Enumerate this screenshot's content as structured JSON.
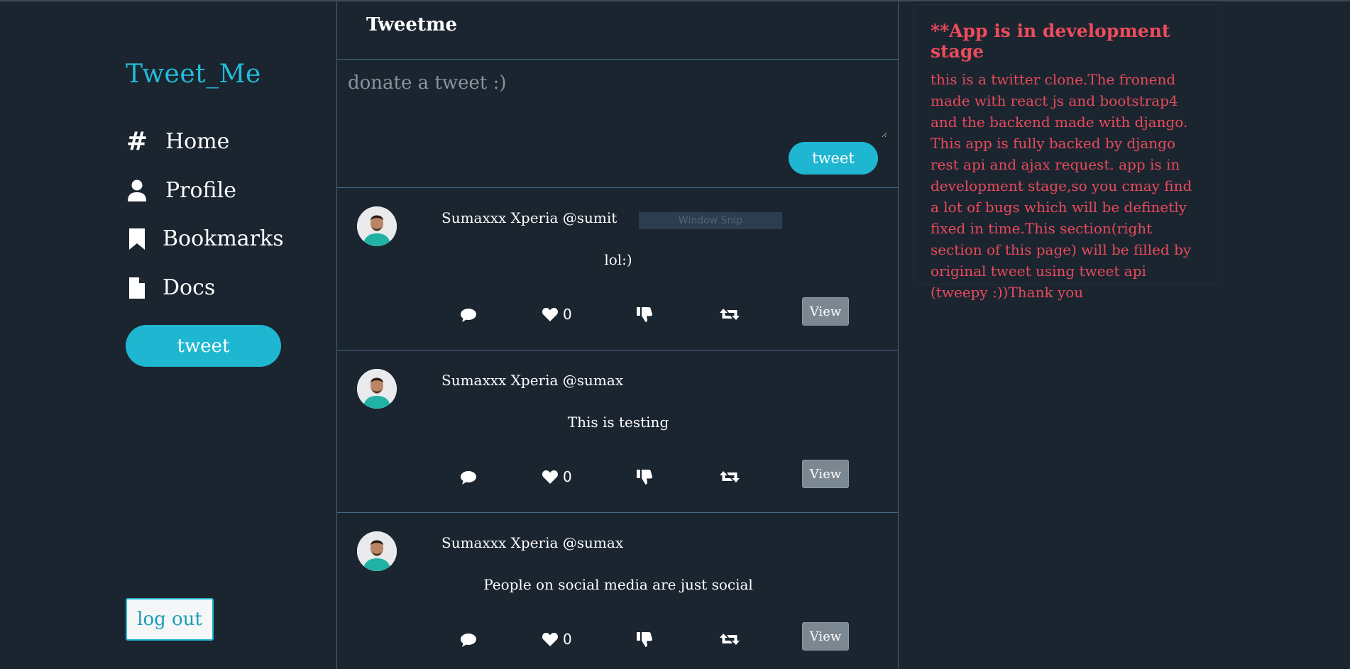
{
  "sidebar": {
    "brand": "Tweet_Me",
    "nav": [
      {
        "label": "Home",
        "icon": "hash-icon"
      },
      {
        "label": "Profile",
        "icon": "user-icon"
      },
      {
        "label": "Bookmarks",
        "icon": "bookmark-icon"
      },
      {
        "label": "Docs",
        "icon": "file-icon"
      }
    ],
    "tweet_button": "tweet",
    "logout_button": "log out"
  },
  "feed": {
    "title": "Tweetme",
    "composer": {
      "placeholder": "donate a tweet :)",
      "button": "tweet"
    },
    "tweets": [
      {
        "author": "Sumaxxx Xperia @sumit",
        "text": "lol:)",
        "likes": "0",
        "view_label": "View",
        "overlay": "Window Snip"
      },
      {
        "author": "Sumaxxx Xperia @sumax",
        "text": "This is testing",
        "likes": "0",
        "view_label": "View"
      },
      {
        "author": "Sumaxxx Xperia @sumax",
        "text": "People on social media are just social",
        "likes": "0",
        "view_label": "View"
      }
    ]
  },
  "info": {
    "title": "**App is in development stage",
    "body": "this is a twitter clone.The fronend made with react js and bootstrap4 and the backend made with django. This app is fully backed by django rest api and ajax request. app is in development stage,so you cmay find a lot of bugs which will be definetly fixed in time.This section(right section of this page) will be filled by original tweet using tweet api (tweepy :))Thank you"
  },
  "colors": {
    "background": "#1b2530",
    "accent": "#1fb6d2",
    "warning_text": "#e84a5a"
  }
}
